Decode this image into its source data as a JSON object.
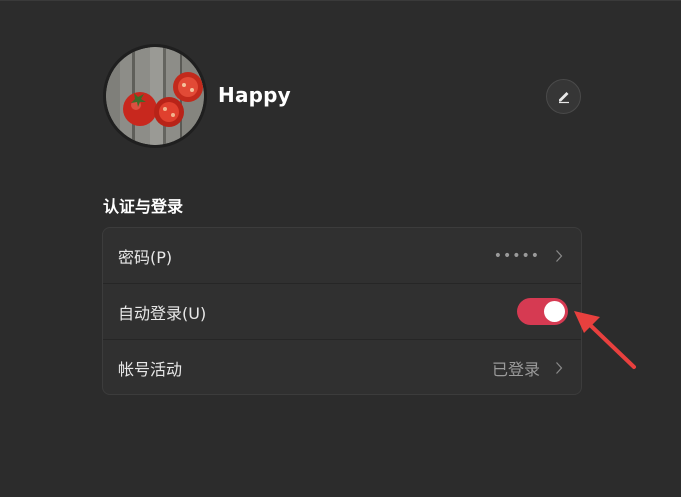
{
  "user": {
    "name": "Happy"
  },
  "auth": {
    "section_title": "认证与登录",
    "rows": [
      {
        "label": "密码(P)",
        "value": "•••••"
      },
      {
        "label": "自动登录(U)",
        "value": "",
        "toggle_on": true
      },
      {
        "label": "帐号活动",
        "value": "已登录"
      }
    ]
  },
  "colors": {
    "background": "#2c2c2c",
    "toggle_on": "#d63a52",
    "annotation_arrow": "#e8403e"
  },
  "icons": {
    "edit": "pencil-icon",
    "chevron": "chevron-right-icon"
  }
}
